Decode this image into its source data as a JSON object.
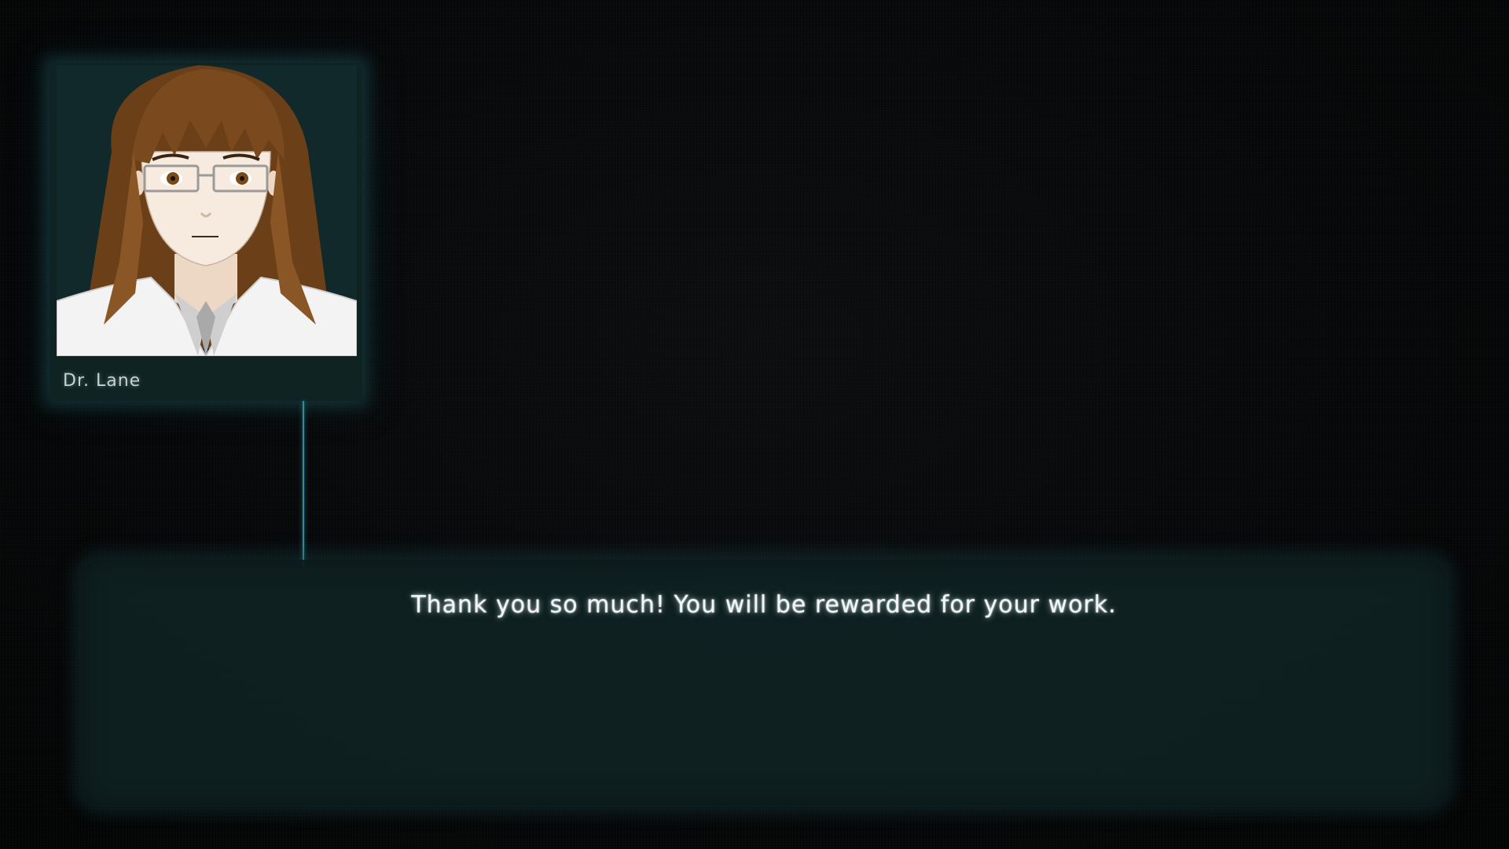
{
  "speaker": {
    "name": "Dr. Lane",
    "portrait_icon": "scientist-portrait-icon"
  },
  "dialogue": {
    "text": "Thank you so much! You will be rewarded for your work."
  },
  "colors": {
    "background": "#050607",
    "panel": "#0f2323",
    "glow": "#2a8ea0",
    "text": "#f2f6f6",
    "hair": "#7a4a1e",
    "coat": "#f2f2f2"
  }
}
